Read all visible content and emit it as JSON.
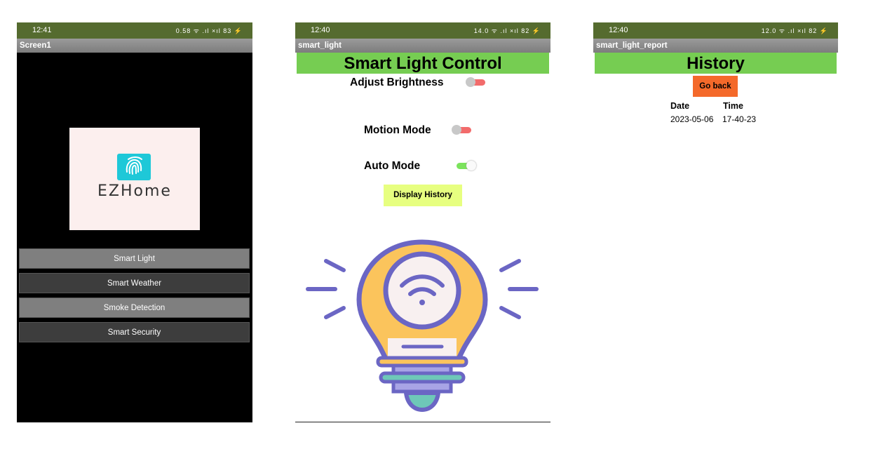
{
  "screen1": {
    "status_time": "12:41",
    "status_icons": "0.58 ᯤ .ıl ×ıl 83 ⚡",
    "title": "Screen1",
    "logo_text": "EZHome",
    "menu": [
      "Smart Light",
      "Smart Weather",
      "Smoke Detection",
      "Smart Security"
    ]
  },
  "screen2": {
    "status_time": "12:40",
    "status_icons": "14.0 ᯤ .ıl ×ıl 82 ⚡",
    "title": "smart_light",
    "heading": "Smart Light Control",
    "adjust_brightness": "Adjust Brightness",
    "motion_mode": "Motion Mode",
    "auto_mode": "Auto Mode",
    "display_history": "Display History",
    "toggles": {
      "adjust_brightness": false,
      "motion_mode": false,
      "auto_mode": true
    }
  },
  "screen3": {
    "status_time": "12:40",
    "status_icons": "12.0 ᯤ .ıl ×ıl 82 ⚡",
    "title": "smart_light_report",
    "heading": "History",
    "go_back": "Go back",
    "col_date": "Date",
    "col_time": "Time",
    "row_date": "2023-05-06",
    "row_time": "17-40-23"
  },
  "colors": {
    "status_bar": "#556b2f",
    "header_green": "#76cd52",
    "go_back": "#f4692a",
    "display_history": "#e7ff80",
    "toggle_off_track": "#f26b6b",
    "toggle_on_track": "#7be35c"
  }
}
